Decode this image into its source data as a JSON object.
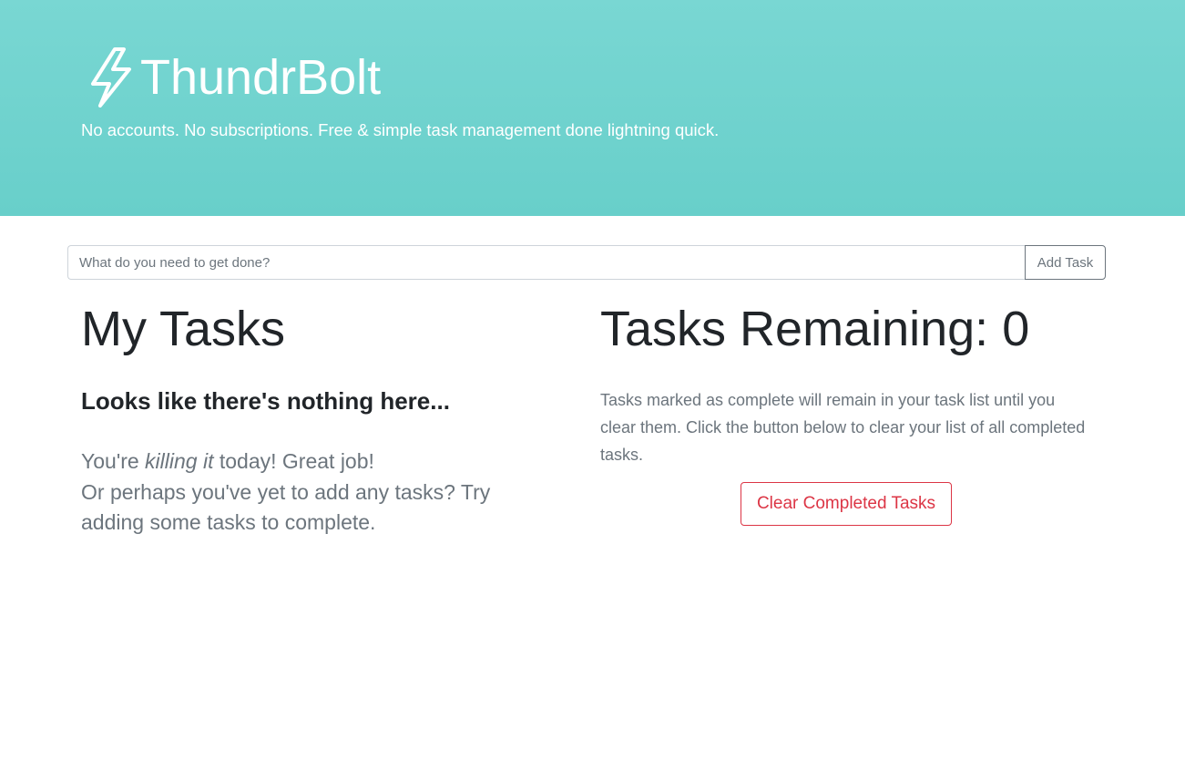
{
  "header": {
    "title": "ThundrBolt",
    "tagline": "No accounts. No subscriptions. Free & simple task management done lightning quick.",
    "icon": "lightning-bolt-icon",
    "background_color": "#6fd3ce"
  },
  "task_form": {
    "placeholder": "What do you need to get done?",
    "value": "",
    "add_label": "Add Task"
  },
  "my_tasks": {
    "title": "My Tasks",
    "empty_heading": "Looks like there's nothing here...",
    "empty_line1_prefix": "You're ",
    "empty_line1_emphasis": "killing it",
    "empty_line1_suffix": " today! Great job!",
    "empty_line2": "Or perhaps you've yet to add any tasks? Try adding some tasks to complete."
  },
  "remaining": {
    "label": "Tasks Remaining: ",
    "count": "0",
    "info": "Tasks marked as complete will remain in your task list until you clear them. Click the button below to clear your list of all completed tasks.",
    "clear_label": "Clear Completed Tasks",
    "danger_color": "#dc3545"
  }
}
